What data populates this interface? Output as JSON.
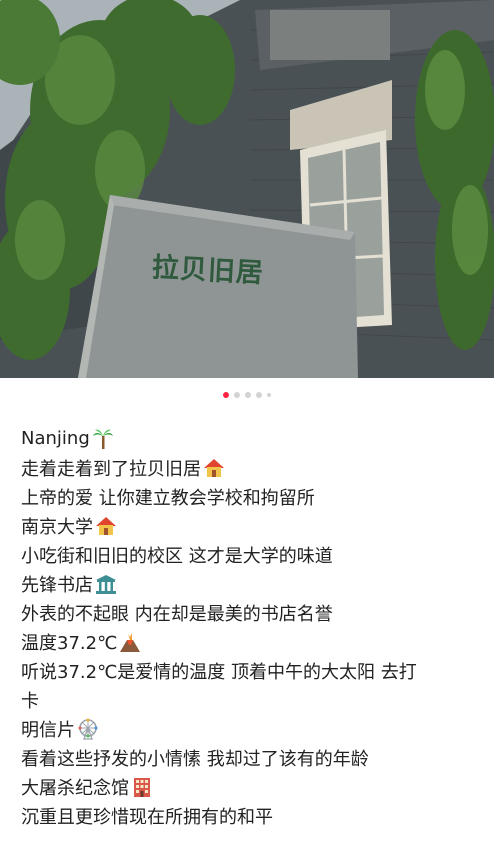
{
  "photo": {
    "sign_text": "拉贝旧居"
  },
  "carousel": {
    "total": 5,
    "active_index": 0
  },
  "post": {
    "lines": [
      {
        "text": "Nanjing",
        "icon": "palm-tree-icon"
      },
      {
        "text": "走着走着到了拉贝旧居",
        "icon": "house-icon"
      },
      {
        "text": "上帝的爱 让你建立教会学校和拘留所",
        "icon": ""
      },
      {
        "text": "南京大学",
        "icon": "house-icon"
      },
      {
        "text": "小吃街和旧旧的校区 这才是大学的味道",
        "icon": ""
      },
      {
        "text": "先锋书店",
        "icon": "classical-building-icon"
      },
      {
        "text": "外表的不起眼 内在却是最美的书店名誉",
        "icon": ""
      },
      {
        "text": "温度37.2℃",
        "icon": "volcano-icon"
      },
      {
        "text": "听说37.2℃是爱情的温度 顶着中午的大太阳 去打",
        "icon": ""
      },
      {
        "text": "卡",
        "icon": ""
      },
      {
        "text": "明信片",
        "icon": "ferris-wheel-icon"
      },
      {
        "text": "看着这些抒发的小情愫 我却过了该有的年龄",
        "icon": ""
      },
      {
        "text": "大屠杀纪念馆",
        "icon": "office-building-icon"
      },
      {
        "text": "沉重且更珍惜现在所拥有的和平",
        "icon": ""
      }
    ]
  }
}
